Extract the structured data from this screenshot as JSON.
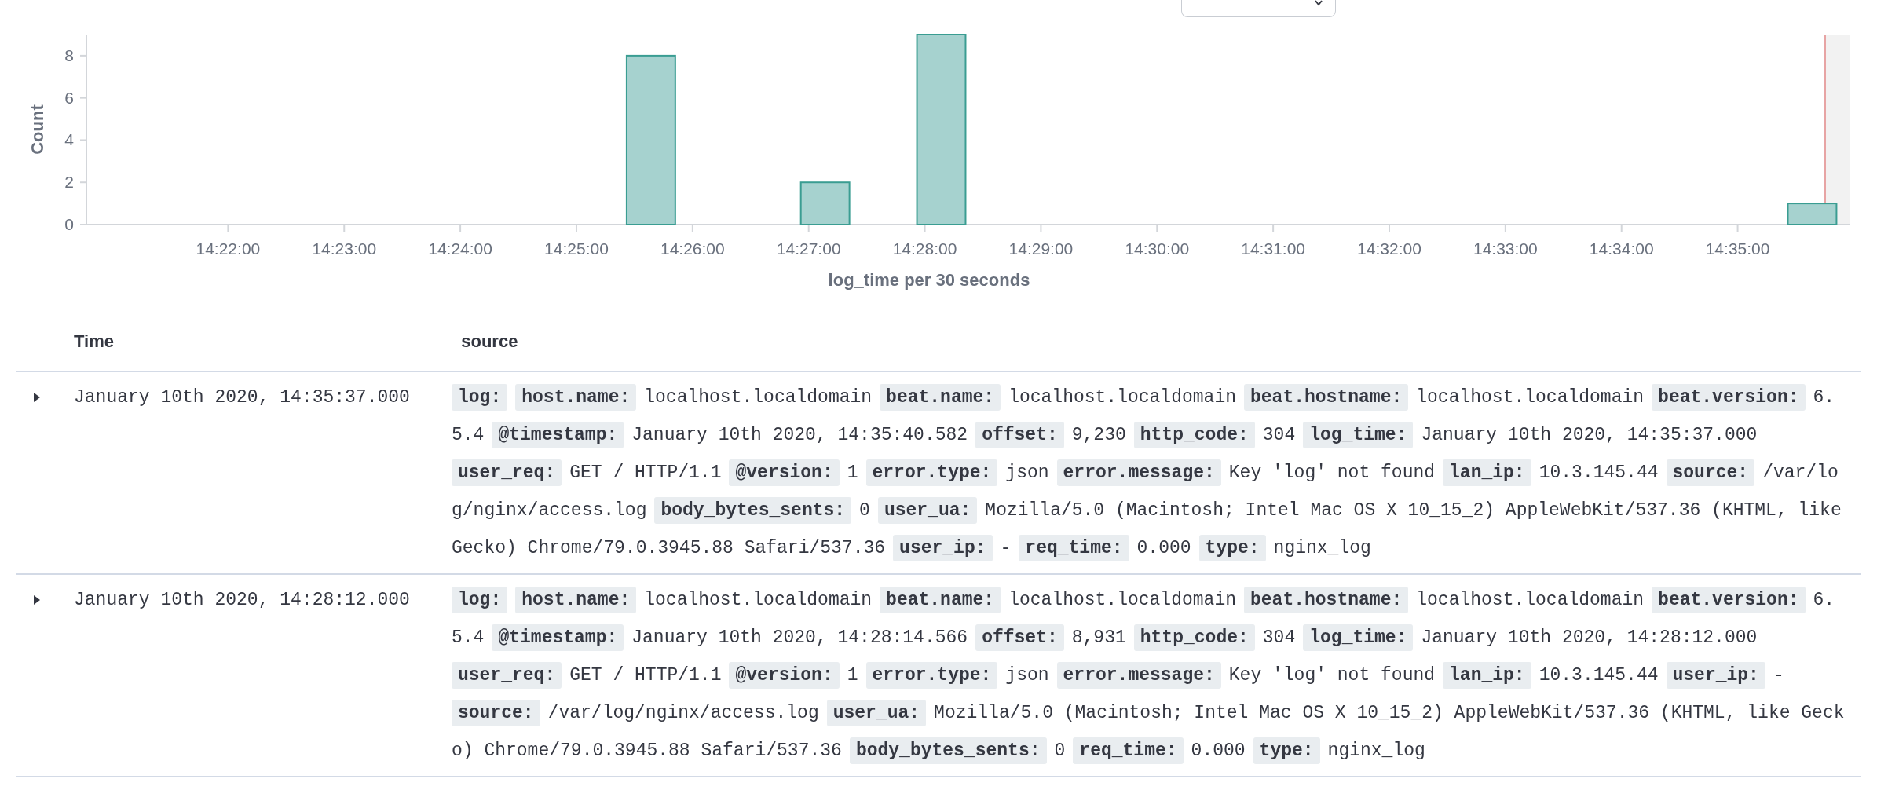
{
  "histogram": {
    "chart_data": {
      "type": "bar",
      "xlabel": "log_time per 30 seconds",
      "ylabel": "Count",
      "categories": [
        null,
        null,
        "14:22:00",
        null,
        "14:23:00",
        null,
        "14:24:00",
        null,
        "14:25:00",
        null,
        "14:26:00",
        null,
        "14:27:00",
        null,
        "14:28:00",
        null,
        "14:29:00",
        null,
        "14:30:00",
        null,
        "14:31:00",
        null,
        "14:32:00",
        null,
        "14:33:00",
        null,
        "14:34:00",
        null,
        "14:35:00",
        null
      ],
      "series": [
        {
          "color": "#a6d2cf",
          "values": [
            0,
            0,
            0,
            0,
            0,
            0,
            0,
            0,
            0,
            8,
            0,
            0,
            2,
            0,
            9,
            0,
            0,
            0,
            0,
            0,
            0,
            0,
            0,
            0,
            0,
            0,
            0,
            0,
            0,
            1
          ]
        }
      ],
      "ylim": [
        0,
        9
      ],
      "yticks": [
        0,
        2,
        4,
        6,
        8
      ]
    }
  },
  "table": {
    "columns": [
      "Time",
      "_source"
    ],
    "rows": [
      {
        "expanded": false,
        "time": "January 10th 2020, 14:35:37.000",
        "fields": [
          {
            "key": "log:"
          },
          {
            "key": "host.name:",
            "value": "localhost.localdomain"
          },
          {
            "key": "beat.name:",
            "value": "localhost.localdomain"
          },
          {
            "key": "beat.hostname:",
            "value": "localhost.localdomain"
          },
          {
            "key": "beat.version:",
            "value": "6.5.4"
          },
          {
            "key": "@timestamp:",
            "value": "January 10th 2020, 14:35:40.582"
          },
          {
            "key": "offset:",
            "value": "9,230"
          },
          {
            "key": "http_code:",
            "value": "304"
          },
          {
            "key": "log_time:",
            "value": "January 10th 2020, 14:35:37.000"
          },
          {
            "key": "user_req:",
            "value": "GET / HTTP/1.1"
          },
          {
            "key": "@version:",
            "value": "1"
          },
          {
            "key": "error.type:",
            "value": "json"
          },
          {
            "key": "error.message:",
            "value": "Key 'log' not found"
          },
          {
            "key": "lan_ip:",
            "value": "10.3.145.44"
          },
          {
            "key": "source:",
            "value": "/var/log/nginx/access.log"
          },
          {
            "key": "body_bytes_sents:",
            "value": "0"
          },
          {
            "key": "user_ua:",
            "value": "Mozilla/5.0 (Macintosh; Intel Mac OS X 10_15_2) AppleWebKit/537.36 (KHTML, like Gecko) Chrome/79.0.3945.88 Safari/537.36"
          },
          {
            "key": "user_ip:",
            "value": "-"
          },
          {
            "key": "req_time:",
            "value": "0.000"
          },
          {
            "key": "type:",
            "value": "nginx_log"
          }
        ]
      },
      {
        "expanded": false,
        "time": "January 10th 2020, 14:28:12.000",
        "fields": [
          {
            "key": "log:"
          },
          {
            "key": "host.name:",
            "value": "localhost.localdomain"
          },
          {
            "key": "beat.name:",
            "value": "localhost.localdomain"
          },
          {
            "key": "beat.hostname:",
            "value": "localhost.localdomain"
          },
          {
            "key": "beat.version:",
            "value": "6.5.4"
          },
          {
            "key": "@timestamp:",
            "value": "January 10th 2020, 14:28:14.566"
          },
          {
            "key": "offset:",
            "value": "8,931"
          },
          {
            "key": "http_code:",
            "value": "304"
          },
          {
            "key": "log_time:",
            "value": "January 10th 2020, 14:28:12.000"
          },
          {
            "key": "user_req:",
            "value": "GET / HTTP/1.1"
          },
          {
            "key": "@version:",
            "value": "1"
          },
          {
            "key": "error.type:",
            "value": "json"
          },
          {
            "key": "error.message:",
            "value": "Key 'log' not found"
          },
          {
            "key": "lan_ip:",
            "value": "10.3.145.44"
          },
          {
            "key": "user_ip:",
            "value": "-"
          },
          {
            "key": "source:",
            "value": "/var/log/nginx/access.log"
          },
          {
            "key": "user_ua:",
            "value": "Mozilla/5.0 (Macintosh; Intel Mac OS X 10_15_2) AppleWebKit/537.36 (KHTML, like Gecko) Chrome/79.0.3945.88 Safari/537.36"
          },
          {
            "key": "body_bytes_sents:",
            "value": "0"
          },
          {
            "key": "req_time:",
            "value": "0.000"
          },
          {
            "key": "type:",
            "value": "nginx_log"
          }
        ]
      }
    ]
  }
}
